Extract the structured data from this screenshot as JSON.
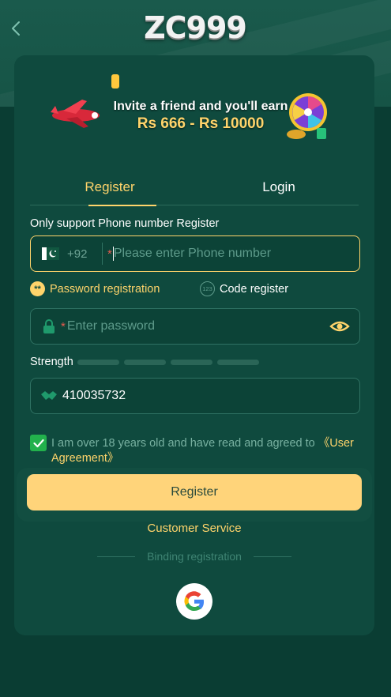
{
  "header": {
    "logo_text": "ZC999"
  },
  "banner": {
    "line1": "Invite a friend and you'll earn",
    "line2": "Rs 666 - Rs 10000"
  },
  "tabs": [
    {
      "label": "Register",
      "active": true
    },
    {
      "label": "Login",
      "active": false
    }
  ],
  "form": {
    "note": "Only support Phone number Register",
    "phone": {
      "country_code": "+92",
      "required_mark": "*",
      "placeholder": "Please enter Phone number",
      "value": ""
    },
    "modes": {
      "password_label": "Password registration",
      "password_icon_text": "**",
      "code_label": "Code register",
      "code_icon_text": "123"
    },
    "password": {
      "required_mark": "*",
      "placeholder": "Enter password",
      "value": ""
    },
    "strength_label": "Strength",
    "invite_code": {
      "value": "410035732"
    },
    "agreement": {
      "checked": true,
      "text": "I am over 18 years old and have read and agreed to ",
      "link": "《User Agreement》"
    },
    "submit_label": "Register"
  },
  "footer": {
    "customer_service": "Customer Service",
    "binding_label": "Binding registration"
  },
  "colors": {
    "page_bg": "#0a3d33",
    "card_bg": "#0f4a3e",
    "accent": "#ffd46b",
    "button": "#ffd47a",
    "checkbox": "#22b14c"
  }
}
